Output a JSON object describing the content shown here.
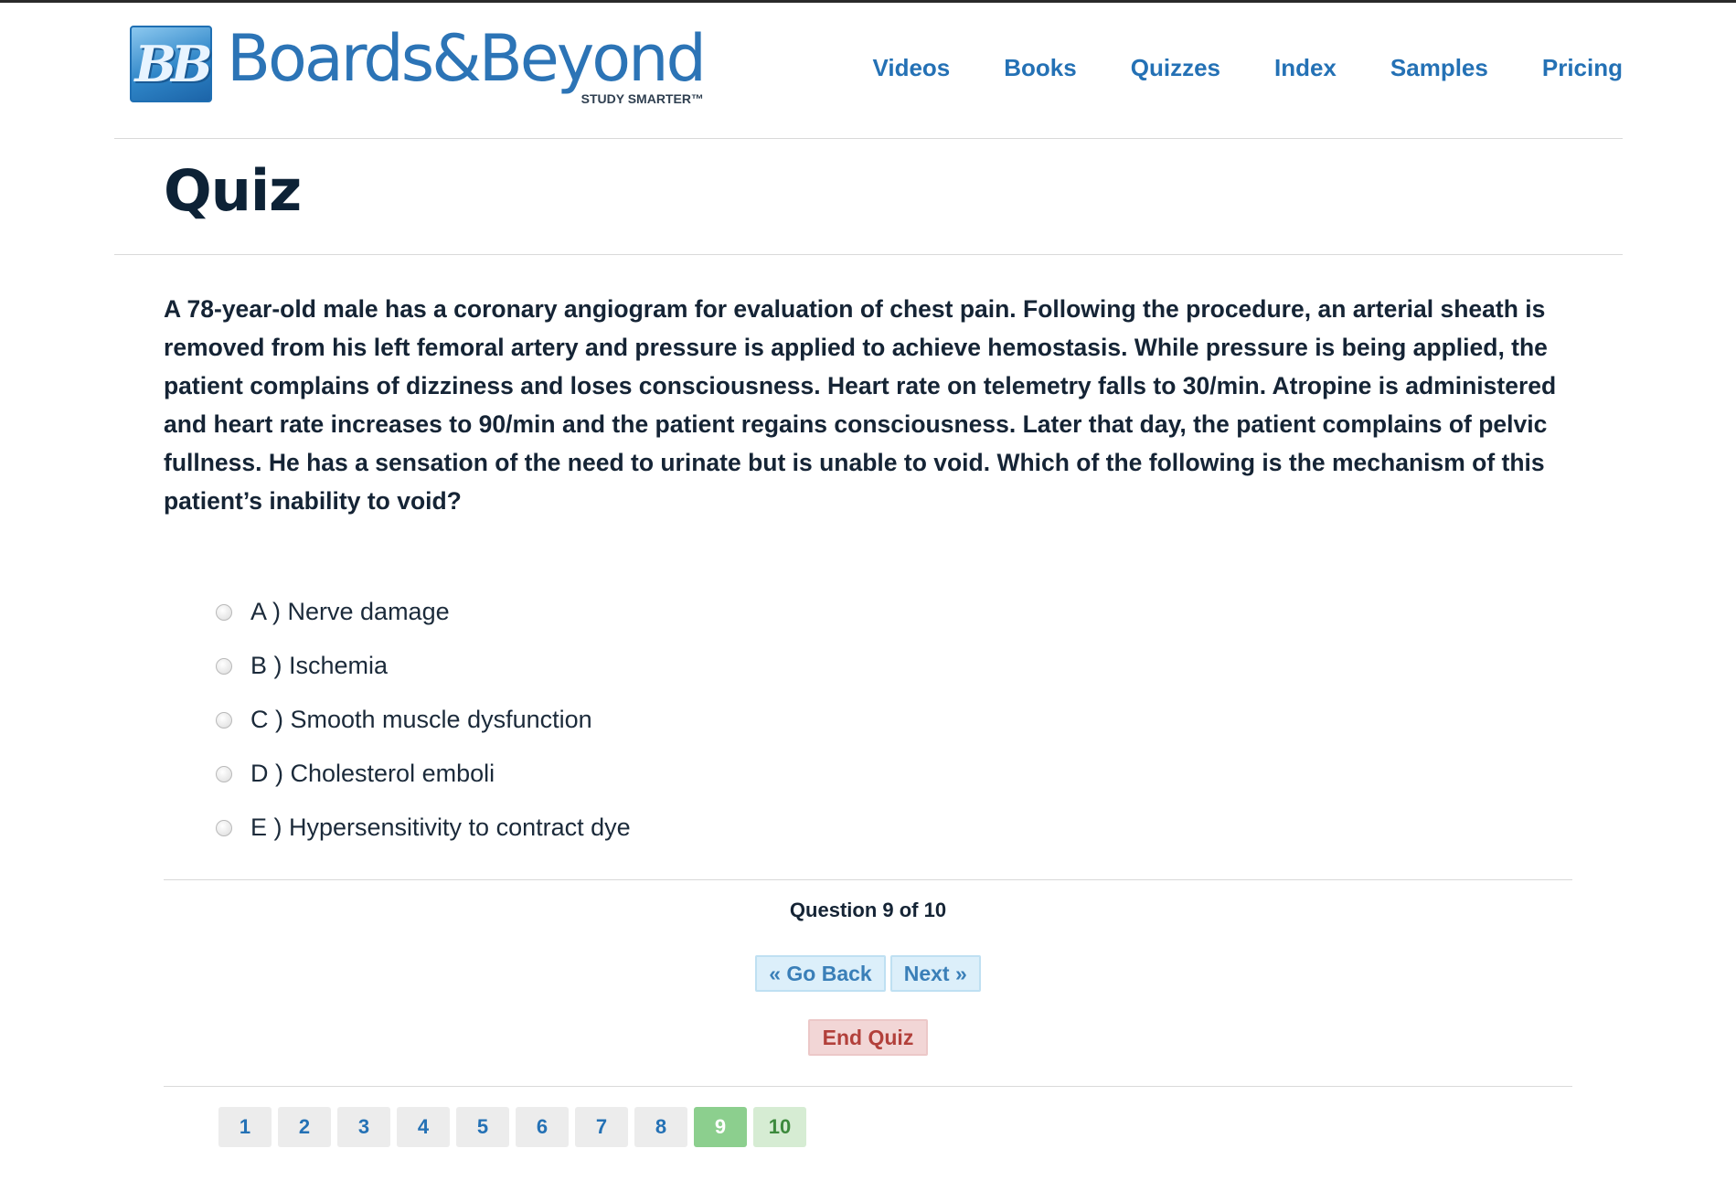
{
  "header": {
    "logo_mark": "BB",
    "logo_name": "Boards&Beyond",
    "logo_tagline": "STUDY SMARTER™",
    "nav": [
      "Videos",
      "Books",
      "Quizzes",
      "Index",
      "Samples",
      "Pricing"
    ]
  },
  "page_title": "Quiz",
  "question_text": "A 78-year-old male has a coronary angiogram for evaluation of chest pain.  Following the procedure, an arterial sheath is removed from his left femoral artery and pressure is applied to achieve hemostasis. While pressure is being applied, the patient complains of dizziness and loses consciousness. Heart rate on telemetry falls to 30/min. Atropine is administered and heart rate increases to 90/min and the patient regains consciousness. Later that day, the patient complains of pelvic fullness. He has a sensation of the need to urinate but is unable to void. Which of the following is the mechanism of this patient’s inability to void?",
  "options": [
    "A ) Nerve damage",
    "B ) Ischemia",
    "C ) Smooth muscle dysfunction",
    "D ) Cholesterol emboli",
    "E ) Hypersensitivity to contract dye"
  ],
  "progress": "Question 9 of 10",
  "buttons": {
    "go_back": "« Go Back",
    "next": "Next »",
    "end_quiz": "End Quiz"
  },
  "pager": {
    "pages": [
      "1",
      "2",
      "3",
      "4",
      "5",
      "6",
      "7",
      "8",
      "9",
      "10"
    ],
    "current": "9"
  },
  "colors": {
    "nav_link": "#2471b5",
    "current_page": "#8ccf8e",
    "end_quiz": "#b2403b",
    "nav_button_bg": "#dceffa"
  }
}
